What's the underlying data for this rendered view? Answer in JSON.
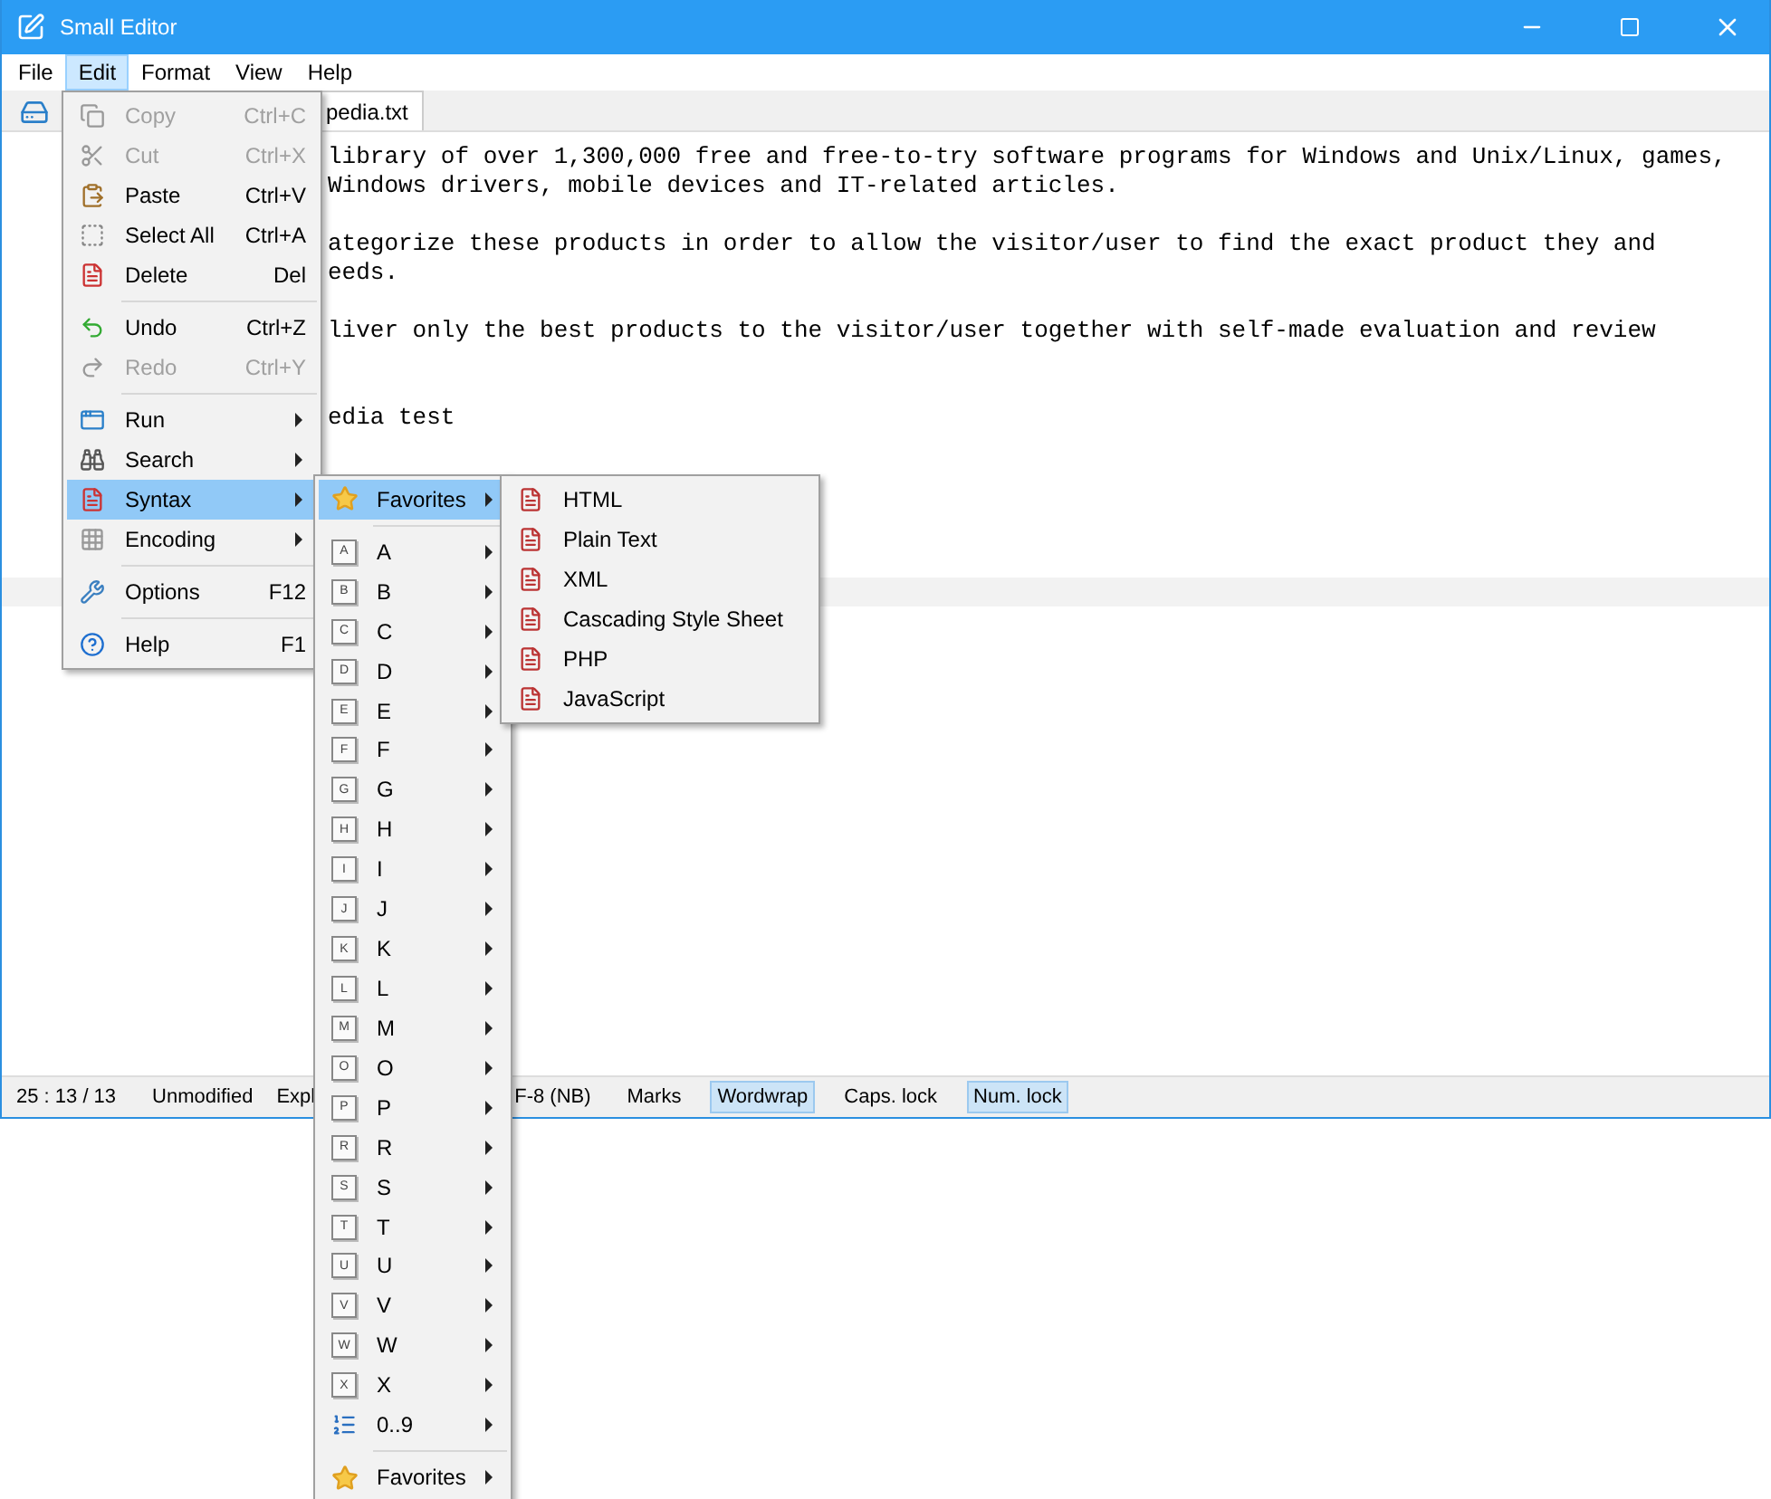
{
  "window": {
    "title": "Small Editor"
  },
  "menu_bar": [
    {
      "label": "File",
      "selected": false
    },
    {
      "label": "Edit",
      "selected": true
    },
    {
      "label": "Format",
      "selected": false
    },
    {
      "label": "View",
      "selected": false
    },
    {
      "label": "Help",
      "selected": false
    }
  ],
  "tabs": [
    {
      "label": "pedia.txt",
      "selected": true
    }
  ],
  "editor": {
    "lines": [
      {
        "text": "library of over 1,300,000 free and free-to-try software programs for Windows and Unix/Linux, games,",
        "kind": "text"
      },
      {
        "text": "Windows drivers, mobile devices and IT-related articles.",
        "kind": "text"
      },
      {
        "kind": "blank"
      },
      {
        "text": "ategorize these products in order to allow the visitor/user to find the exact product they and",
        "kind": "text"
      },
      {
        "text": "eeds.",
        "kind": "text"
      },
      {
        "kind": "blank"
      },
      {
        "text": "liver only the best products to the visitor/user together with self-made evaluation and review",
        "kind": "text"
      },
      {
        "kind": "blank"
      },
      {
        "kind": "blank"
      },
      {
        "text": "edia test",
        "kind": "text"
      }
    ]
  },
  "edit_menu": {
    "groups": [
      [
        {
          "label": "Copy",
          "shortcut": "Ctrl+C",
          "disabled": true,
          "selected": false,
          "submenu": false
        },
        {
          "label": "Cut",
          "shortcut": "Ctrl+X",
          "disabled": true,
          "selected": false,
          "submenu": false
        },
        {
          "label": "Paste",
          "shortcut": "Ctrl+V",
          "disabled": false,
          "selected": false,
          "submenu": false
        },
        {
          "label": "Select All",
          "shortcut": "Ctrl+A",
          "disabled": false,
          "selected": false,
          "submenu": false
        },
        {
          "label": "Delete",
          "shortcut": "Del",
          "disabled": false,
          "selected": false,
          "submenu": false
        }
      ],
      [
        {
          "label": "Undo",
          "shortcut": "Ctrl+Z",
          "disabled": false,
          "selected": false,
          "submenu": false
        },
        {
          "label": "Redo",
          "shortcut": "Ctrl+Y",
          "disabled": true,
          "selected": false,
          "submenu": false
        }
      ],
      [
        {
          "label": "Run",
          "disabled": false,
          "selected": false,
          "submenu": true
        },
        {
          "label": "Search",
          "disabled": false,
          "selected": false,
          "submenu": true
        },
        {
          "label": "Syntax",
          "disabled": false,
          "selected": true,
          "submenu": true
        },
        {
          "label": "Encoding",
          "disabled": false,
          "selected": false,
          "submenu": true
        }
      ],
      [
        {
          "label": "Options",
          "shortcut": "F12",
          "disabled": false,
          "selected": false,
          "submenu": false
        }
      ],
      [
        {
          "label": "Help",
          "shortcut": "F1",
          "disabled": false,
          "selected": false,
          "submenu": false
        }
      ]
    ]
  },
  "syntax_menu": {
    "groups": [
      [
        {
          "label": "Favorites",
          "kind": "star",
          "selected": true
        }
      ],
      [
        {
          "label": "A",
          "key": "A",
          "kind": "letter",
          "selected": false
        },
        {
          "label": "B",
          "key": "B",
          "kind": "letter",
          "selected": false
        },
        {
          "label": "C",
          "key": "C",
          "kind": "letter",
          "selected": false
        },
        {
          "label": "D",
          "key": "D",
          "kind": "letter",
          "selected": false
        },
        {
          "label": "E",
          "key": "E",
          "kind": "letter",
          "selected": false
        },
        {
          "label": "F",
          "key": "F",
          "kind": "letter",
          "selected": false
        },
        {
          "label": "G",
          "key": "G",
          "kind": "letter",
          "selected": false
        },
        {
          "label": "H",
          "key": "H",
          "kind": "letter",
          "selected": false
        },
        {
          "label": "I",
          "key": "I",
          "kind": "letter",
          "selected": false
        },
        {
          "label": "J",
          "key": "J",
          "kind": "letter",
          "selected": false
        },
        {
          "label": "K",
          "key": "K",
          "kind": "letter",
          "selected": false
        },
        {
          "label": "L",
          "key": "L",
          "kind": "letter",
          "selected": false
        },
        {
          "label": "M",
          "key": "M",
          "kind": "letter",
          "selected": false
        },
        {
          "label": "O",
          "key": "O",
          "kind": "letter",
          "selected": false
        },
        {
          "label": "P",
          "key": "P",
          "kind": "letter",
          "selected": false
        },
        {
          "label": "R",
          "key": "R",
          "kind": "letter",
          "selected": false
        },
        {
          "label": "S",
          "key": "S",
          "kind": "letter",
          "selected": false
        },
        {
          "label": "T",
          "key": "T",
          "kind": "letter",
          "selected": false
        },
        {
          "label": "U",
          "key": "U",
          "kind": "letter",
          "selected": false
        },
        {
          "label": "V",
          "key": "V",
          "kind": "letter",
          "selected": false
        },
        {
          "label": "W",
          "key": "W",
          "kind": "letter",
          "selected": false
        },
        {
          "label": "X",
          "key": "X",
          "kind": "letter",
          "selected": false
        },
        {
          "label": "0..9",
          "kind": "numbers",
          "selected": false
        }
      ],
      [
        {
          "label": "Favorites",
          "kind": "star",
          "selected": false
        }
      ]
    ]
  },
  "favorites_menu": {
    "items": [
      {
        "label": "HTML"
      },
      {
        "label": "Plain Text"
      },
      {
        "label": "XML"
      },
      {
        "label": "Cascading Style Sheet"
      },
      {
        "label": "PHP"
      },
      {
        "label": "JavaScript"
      }
    ]
  },
  "status_bar": [
    {
      "text": "25 : 13 / 13",
      "on": false
    },
    {
      "text": "Unmodified",
      "on": false
    },
    {
      "text": "Expl",
      "on": false
    },
    {
      "text": "F-8 (NB)",
      "on": false
    },
    {
      "text": "Marks",
      "on": false
    },
    {
      "text": "Wordwrap",
      "on": true
    },
    {
      "text": "Caps. lock",
      "on": false
    },
    {
      "text": "Num. lock",
      "on": true
    }
  ]
}
